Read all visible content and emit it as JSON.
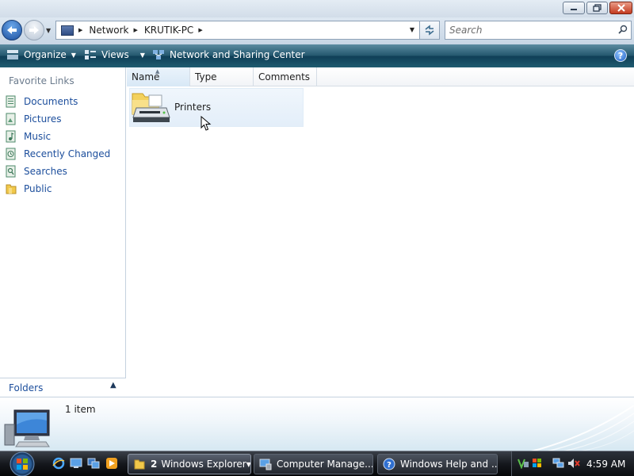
{
  "address": {
    "crumbs": [
      "Network",
      "KRUTIK-PC"
    ],
    "search_placeholder": "Search"
  },
  "commandbar": {
    "organize": "Organize",
    "views": "Views",
    "network_center": "Network and Sharing Center",
    "help": "?"
  },
  "navpane": {
    "title": "Favorite Links",
    "links": [
      "Documents",
      "Pictures",
      "Music",
      "Recently Changed",
      "Searches",
      "Public"
    ],
    "folders": "Folders"
  },
  "columns": [
    "Name",
    "Type",
    "Comments"
  ],
  "items": [
    {
      "label": "Printers",
      "icon": "printer-folder-icon"
    }
  ],
  "details": {
    "count": "1 item"
  },
  "taskbar": {
    "group_count": "2",
    "tasks": [
      "Windows Explorer",
      "Computer Manage...",
      "Windows Help and ..."
    ],
    "clock": "4:59 AM"
  },
  "colors": {
    "commandbar": "#1f5c70",
    "link": "#1c4e9c",
    "taskbar": "#15181d"
  }
}
